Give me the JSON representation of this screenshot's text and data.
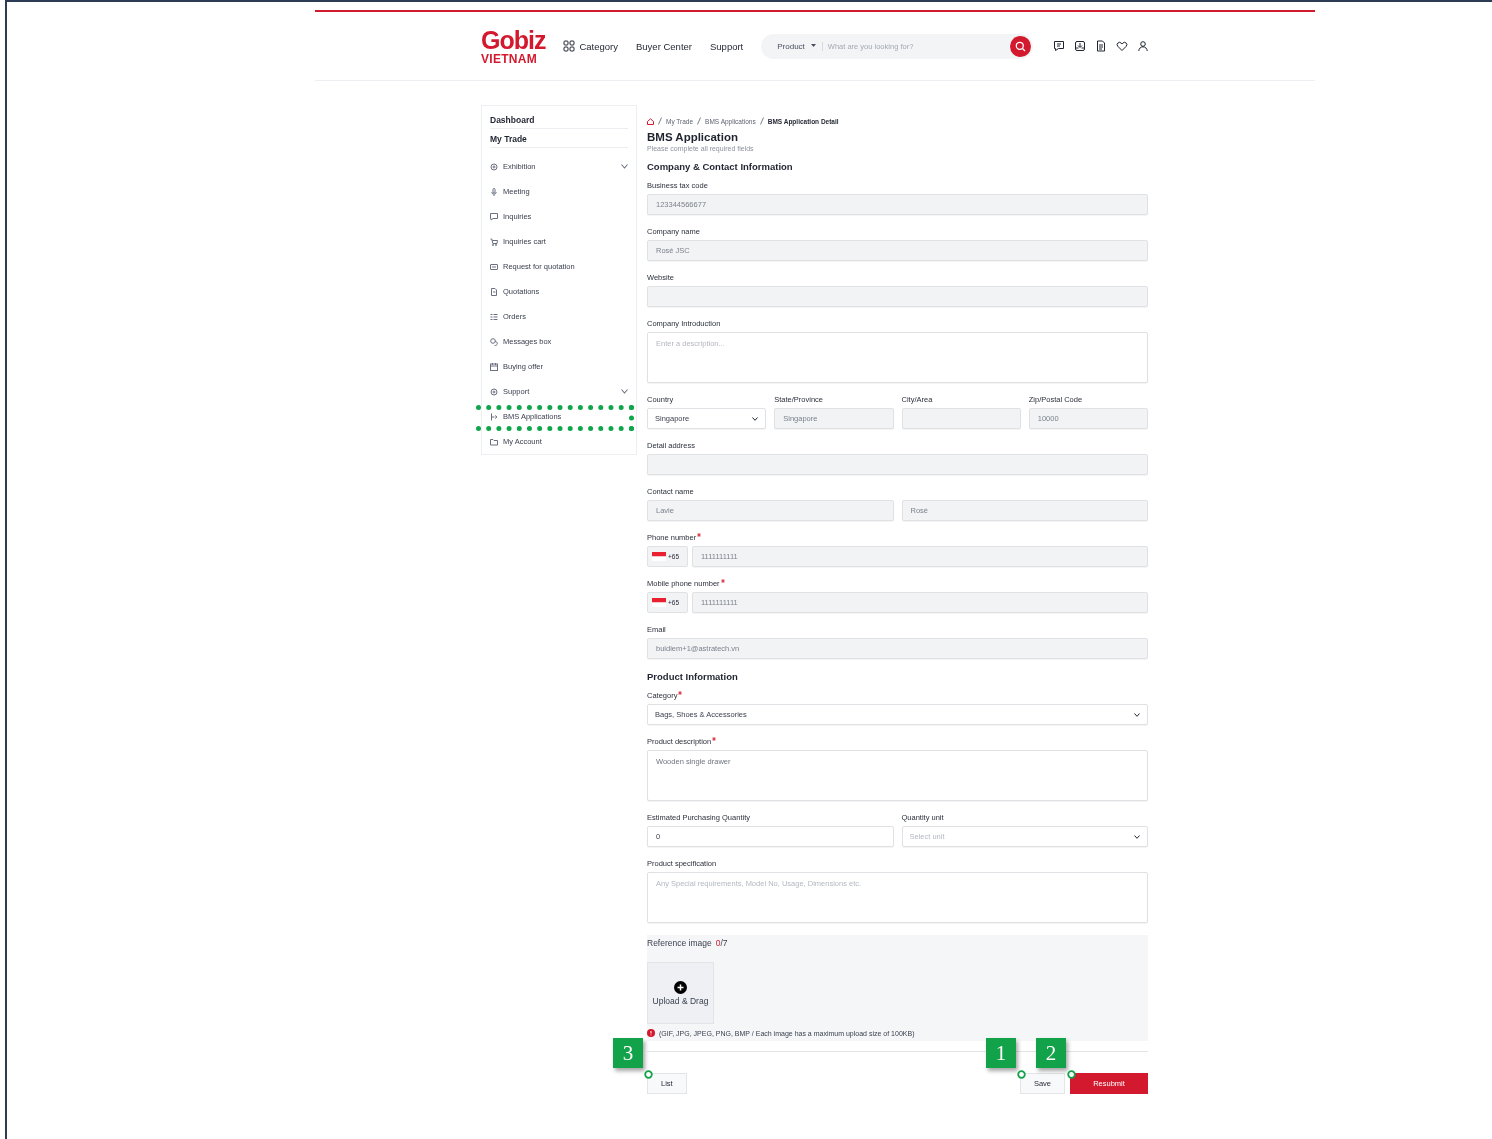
{
  "header": {
    "logo": {
      "brand": "Gobiz",
      "country": "VIETNAM"
    },
    "nav": [
      {
        "label": "Category",
        "kind": "menu"
      },
      {
        "label": "Buyer Center",
        "kind": "link"
      },
      {
        "label": "Support",
        "kind": "link"
      }
    ],
    "search": {
      "scope": "Product",
      "placeholder": "What are you looking for?"
    }
  },
  "sidebar": {
    "headings": [
      "Dashboard",
      "My Trade"
    ],
    "items": [
      {
        "label": "Exhibition",
        "kind": "group",
        "highlighted": false
      },
      {
        "label": "Meeting",
        "kind": "link",
        "highlighted": false
      },
      {
        "label": "Inquiries",
        "kind": "link",
        "highlighted": false
      },
      {
        "label": "Inquiries cart",
        "kind": "link",
        "highlighted": false
      },
      {
        "label": "Request for quotation",
        "kind": "link",
        "highlighted": false
      },
      {
        "label": "Quotations",
        "kind": "link",
        "highlighted": false
      },
      {
        "label": "Orders",
        "kind": "link",
        "highlighted": false
      },
      {
        "label": "Messages box",
        "kind": "link",
        "highlighted": false
      },
      {
        "label": "Buying offer",
        "kind": "link",
        "highlighted": false
      },
      {
        "label": "Support",
        "kind": "group",
        "highlighted": false
      },
      {
        "label": "BMS Applications",
        "kind": "link",
        "highlighted": true
      },
      {
        "label": "My Account",
        "kind": "link",
        "highlighted": false
      }
    ]
  },
  "breadcrumb": [
    "My Trade",
    "BMS Applications",
    "BMS Application Detail"
  ],
  "title": "BMS Application",
  "subtitle": "Please complete all required fields",
  "sections": [
    {
      "title": "Company & Contact Information",
      "fields": [
        {
          "kind": "input",
          "label": "Business tax code",
          "value": "123344566677",
          "disabled": true
        },
        {
          "kind": "input",
          "label": "Company name",
          "value": "Rosé JSC",
          "disabled": true
        },
        {
          "kind": "input",
          "label": "Website",
          "disabled": true
        },
        {
          "kind": "textarea",
          "label": "Company Introduction",
          "placeholder": "Enter a description...",
          "disabled": false
        },
        {
          "kind": "row",
          "columns": [
            {
              "kind": "select",
              "label": "Country",
              "value": "Singapore",
              "disabled": false
            },
            {
              "kind": "input",
              "label": "State/Province",
              "value": "Singapore",
              "disabled": true
            },
            {
              "kind": "input",
              "label": "City/Area",
              "disabled": true
            },
            {
              "kind": "input",
              "label": "Zip/Postal Code",
              "value": "10000",
              "disabled": true
            }
          ]
        },
        {
          "kind": "input",
          "label": "Detail address",
          "disabled": true
        },
        {
          "kind": "row",
          "label": "Contact name",
          "columns": [
            {
              "kind": "input",
              "value": "Lavie",
              "disabled": true
            },
            {
              "kind": "input",
              "value": "Rosé",
              "disabled": true
            }
          ]
        },
        {
          "kind": "phone",
          "label": "Phone number",
          "required": true,
          "code": "+65",
          "value": "1111111111",
          "disabled": true
        },
        {
          "kind": "phone",
          "label": "Mobile phone number",
          "required": true,
          "code": "+65",
          "value": "1111111111",
          "disabled": true
        },
        {
          "kind": "input",
          "label": "Email",
          "value": "buidiem+1@astratech.vn",
          "disabled": true
        }
      ]
    },
    {
      "title": "Product Information",
      "fields": [
        {
          "kind": "select",
          "label": "Category",
          "required": true,
          "value": "Bags, Shoes & Accessories",
          "disabled": false
        },
        {
          "kind": "textarea",
          "label": "Product description",
          "required": true,
          "value": "Wooden single drawer",
          "disabled": false
        },
        {
          "kind": "row",
          "columns": [
            {
              "kind": "input",
              "label": "Estimated Purchasing Quantity",
              "value": "0",
              "disabled": false
            },
            {
              "kind": "select",
              "label": "Quantity unit",
              "placeholder": "Select unit",
              "disabled": false
            }
          ]
        },
        {
          "kind": "textarea",
          "label": "Product specification",
          "placeholder": "Any Special requirements, Model No, Usage, Dimensions etc.",
          "disabled": false
        }
      ]
    }
  ],
  "upload": {
    "label": "Reference image",
    "count": "0",
    "limit": "/7",
    "button": "Upload & Drag",
    "note": "(GIF, JPG, JPEG, PNG, BMP / Each image has a maximum upload size of 100KB)"
  },
  "buttons": [
    {
      "label": "List",
      "kind": "secondary",
      "callout": "3"
    },
    {
      "label": "Save",
      "kind": "secondary",
      "callout": "1"
    },
    {
      "label": "Resubmit",
      "kind": "primary",
      "callout": "2"
    }
  ]
}
